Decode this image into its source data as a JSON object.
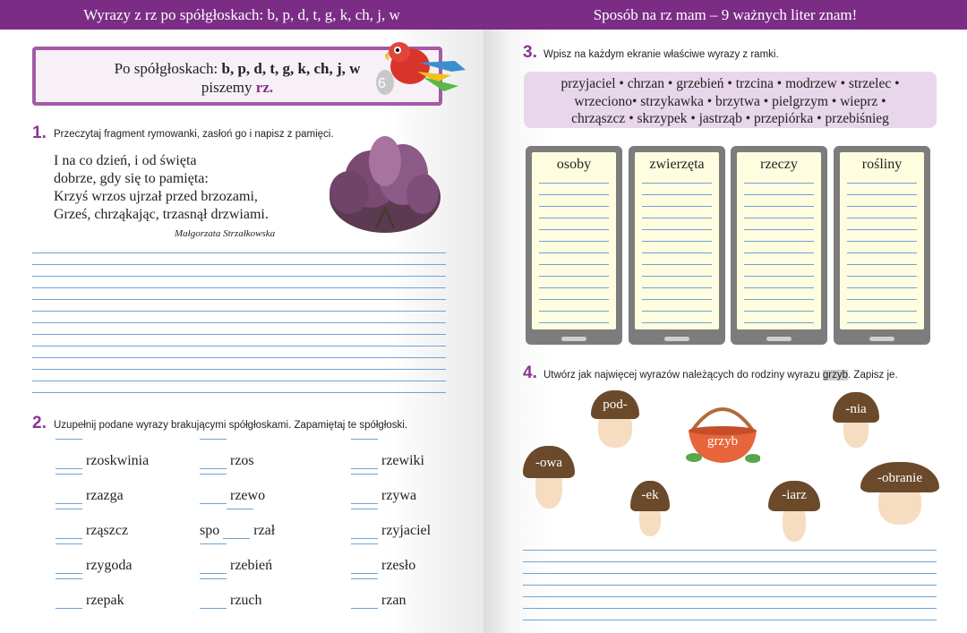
{
  "left_page": {
    "header": "Wyrazy z rz po spółgłoskach: b, p, d, t, g, k, ch, j, w",
    "rule": {
      "line1_prefix": "Po spółgłoskach:",
      "line1_letters": "b, p, d, t, g, k, ch, j, w",
      "line2_prefix": "piszemy",
      "line2_highlight": "rz."
    },
    "task1": {
      "number": "1.",
      "instruction": "Przeczytaj fragment rymowanki, zasłoń go i napisz z pamięci.",
      "poem": [
        "I na co dzień, i od święta",
        "dobrze, gdy się to pamięta:",
        "Krzyś wrzos ujrzał przed brzozami,",
        "Grześ, chrząkając, trzasnął drzwiami."
      ],
      "author": "Małgorzata Strzałkowska"
    },
    "task2": {
      "number": "2.",
      "instruction": "Uzupełnij podane wyrazy brakującymi spółgłoskami. Zapamiętaj te spółgłoski.",
      "col1": [
        "rzoskwinia",
        "rzazga",
        "rząszcz",
        "rzygoda",
        "rzepak"
      ],
      "col2": [
        "rzos",
        "rzewo",
        "rzał",
        "rzebień",
        "rzuch"
      ],
      "col2_prefix": "spo",
      "col3": [
        "rzewiki",
        "rzywa",
        "rzyjaciel",
        "rzesło",
        "rzan"
      ]
    }
  },
  "right_page": {
    "header": "Sposób na rz mam – 9 ważnych liter znam!",
    "task3": {
      "number": "3.",
      "instruction": "Wpisz na każdym ekranie właściwe wyrazy z ramki.",
      "words_line1": "przyjaciel • chrzan • grzebień • trzcina • modrzew • strzelec •",
      "words_line2": "wrzeciono• strzykawka • brzytwa • pielgrzym • wieprz •",
      "words_line3": "chrząszcz • skrzypek • jastrząb • przepiórka • przebiśnieg",
      "screens": [
        "osoby",
        "zwierzęta",
        "rzeczy",
        "rośliny"
      ]
    },
    "task4": {
      "number": "4.",
      "instruction_before": "Utwórz jak najwięcej wyrazów należących do rodziny wyrazu",
      "instruction_word": "grzyb",
      "instruction_after": ". Zapisz je.",
      "basket_label": "grzyb",
      "mushrooms": [
        "pod-",
        "-nia",
        "-owa",
        "-ek",
        "-iarz",
        "-obranie"
      ]
    }
  },
  "colors": {
    "accent": "#7b2d86",
    "line": "#6fa3d8",
    "box": "#e8d6ea"
  }
}
